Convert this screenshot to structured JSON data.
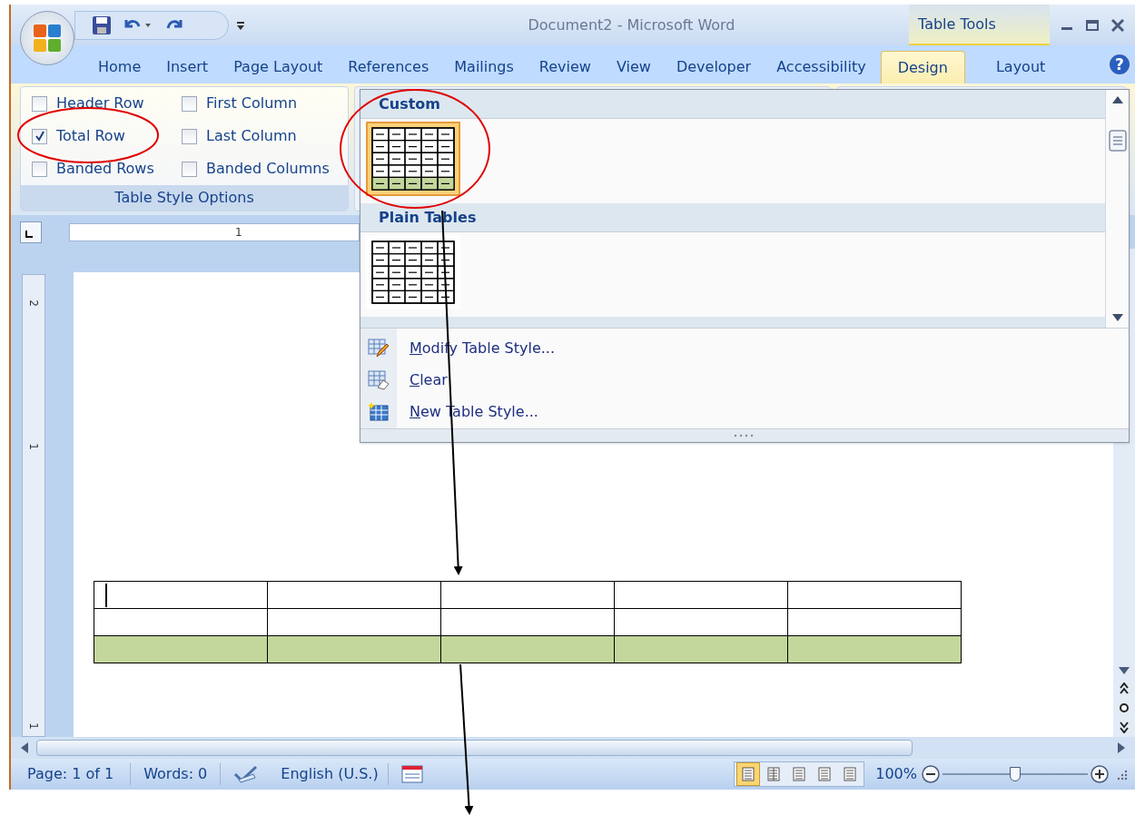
{
  "window": {
    "title": "Document2 - Microsoft Word",
    "contextual_title": "Table Tools"
  },
  "ribbon_tabs": [
    {
      "label": "Home",
      "selected": false,
      "kind": "main"
    },
    {
      "label": "Insert",
      "selected": false,
      "kind": "main"
    },
    {
      "label": "Page Layout",
      "selected": false,
      "kind": "main"
    },
    {
      "label": "References",
      "selected": false,
      "kind": "main"
    },
    {
      "label": "Mailings",
      "selected": false,
      "kind": "main"
    },
    {
      "label": "Review",
      "selected": false,
      "kind": "main"
    },
    {
      "label": "View",
      "selected": false,
      "kind": "main"
    },
    {
      "label": "Developer",
      "selected": false,
      "kind": "main"
    },
    {
      "label": "Accessibility",
      "selected": false,
      "kind": "main"
    },
    {
      "label": "Design",
      "selected": true,
      "kind": "contextual"
    },
    {
      "label": "Layout",
      "selected": false,
      "kind": "contextual"
    }
  ],
  "style_options": {
    "title": "Table Style Options",
    "options": [
      {
        "label": "Header Row",
        "checked": false
      },
      {
        "label": "Total Row",
        "checked": true
      },
      {
        "label": "Banded Rows",
        "checked": false
      },
      {
        "label": "First Column",
        "checked": false
      },
      {
        "label": "Last Column",
        "checked": false
      },
      {
        "label": "Banded Columns",
        "checked": false
      }
    ]
  },
  "gallery": {
    "sections": [
      {
        "title": "Custom",
        "selected": true,
        "shaded_total": true
      },
      {
        "title": "Plain Tables",
        "selected": false,
        "shaded_total": false
      }
    ],
    "menu": [
      {
        "label": "Modify Table Style...",
        "kind": "modify"
      },
      {
        "label": "Clear",
        "kind": "clear"
      },
      {
        "label": "New Table Style...",
        "kind": "new"
      }
    ]
  },
  "help": {
    "glyph": "?"
  },
  "ruler": {
    "h_marks": [
      "1"
    ],
    "v_marks": [
      "2",
      "1",
      "1"
    ]
  },
  "document": {
    "table_rows": [
      {
        "shaded": false,
        "cursor": true
      },
      {
        "shaded": false,
        "cursor": false
      },
      {
        "shaded": true,
        "cursor": false
      }
    ]
  },
  "status_bar": {
    "page": "Page: 1 of 1",
    "words": "Words: 0",
    "language": "English (U.S.)",
    "zoom": "100%",
    "zoom_slider": {
      "level": 0.5
    },
    "views": [
      {
        "selected": true
      },
      {
        "selected": false
      },
      {
        "selected": false
      },
      {
        "selected": false
      },
      {
        "selected": false
      }
    ]
  }
}
